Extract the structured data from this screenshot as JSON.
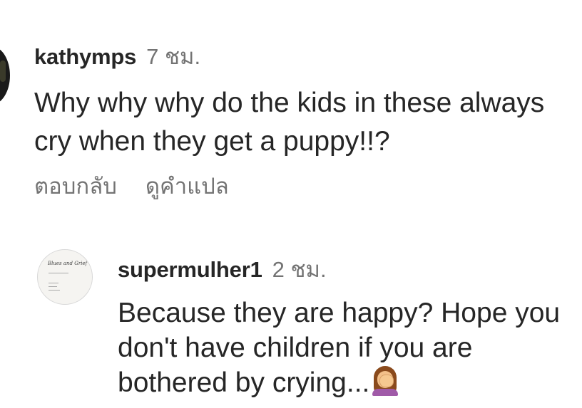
{
  "comments": [
    {
      "username": "kathymps",
      "time": "7 ชม.",
      "text": "Why why why do the kids in these always cry when they get a puppy!!?",
      "actions": {
        "reply": "ตอบกลับ",
        "translate": "ดูคำแปล"
      }
    },
    {
      "username": "supermulher1",
      "time": "2 ชม.",
      "text": "Because they are happy? Hope you don't have children if you are bothered by crying...",
      "emoji": "facepalm-woman-icon",
      "avatar_text": "Blues and Grief"
    }
  ]
}
